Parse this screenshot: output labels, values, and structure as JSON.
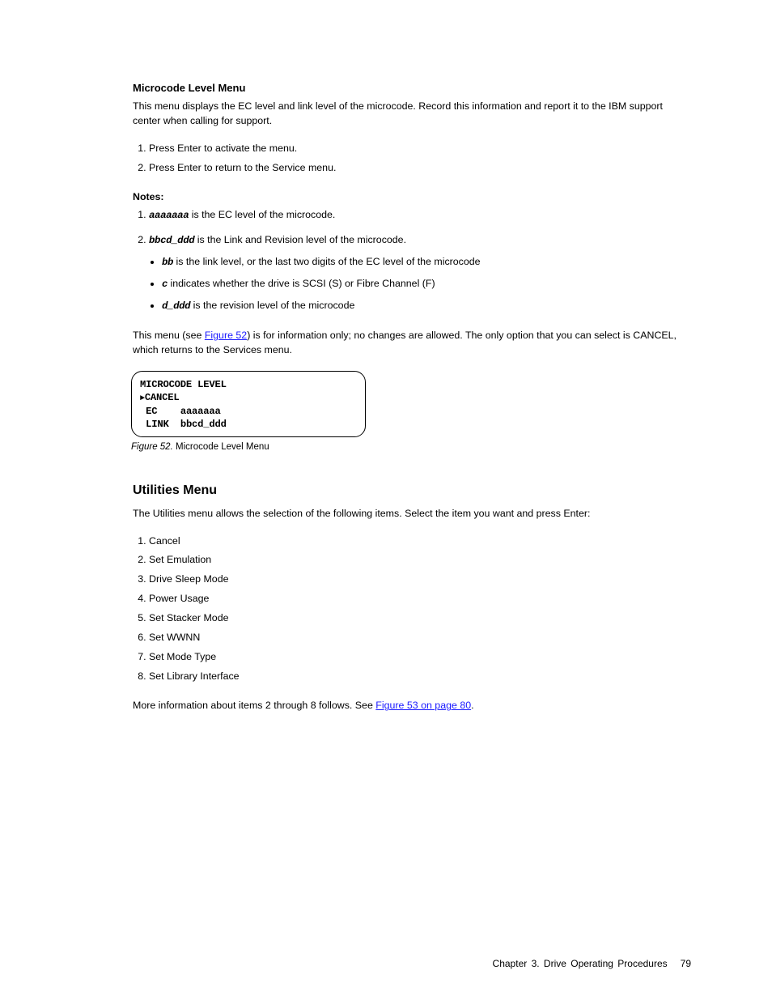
{
  "microcode": {
    "heading": "Microcode Level Menu",
    "intro": "This menu displays the EC level and link level of the microcode. Record this information and report it to the IBM support center when calling for support.",
    "steps": [
      "Press Enter to activate the menu.",
      "Press Enter to return to the Service menu."
    ],
    "notes_label": "Notes:",
    "notes": [
      {
        "lead_bold": "aaaaaaa",
        "lead_rest": " is the EC level of the microcode.",
        "sublist": []
      },
      {
        "lead_bold": "bbcd_ddd",
        "lead_rest": " is the Link and Revision level of the microcode.",
        "sublist": [
          {
            "bold": "bb",
            "rest": " is the link level, or the last two digits of the EC level of the microcode"
          },
          {
            "bold": "c",
            "rest": " indicates whether the drive is SCSI (S) or Fibre Channel (F)"
          },
          {
            "bold": "d_ddd",
            "rest": " is the revision level of the microcode"
          }
        ]
      }
    ],
    "figure_intro_before_link": "This menu (see ",
    "figure_link_text": "Figure 52",
    "figure_intro_after_link": ") is for information only; no changes are allowed. The only option that you can select is CANCEL, which returns to the Services menu.",
    "panel": {
      "title": "MICROCODE LEVEL",
      "line2_cancel": "CANCEL",
      "line3_label": "EC",
      "line3_value": "aaaaaaa",
      "line4_label": "LINK",
      "line4_value": "bbcd_ddd"
    },
    "figure_caption_num": "Figure 52. ",
    "figure_caption_text": "Microcode Level Menu"
  },
  "utilities": {
    "heading": "Utilities Menu",
    "intro": "The Utilities menu allows the selection of the following items. Select the item you want and press Enter:",
    "items": [
      "Cancel",
      "Set Emulation",
      "Drive Sleep Mode",
      "Power Usage",
      "Set Stacker Mode",
      "Set WWNN",
      "Set Mode Type",
      "Set Library Interface"
    ],
    "followups_before_link": "More information about items 2 through 8 follows. See ",
    "followups_link_text": "Figure 53 on page 80",
    "followups_after_link": "."
  },
  "footer": {
    "text": "Chapter 3. Drive Operating Procedures   79"
  }
}
